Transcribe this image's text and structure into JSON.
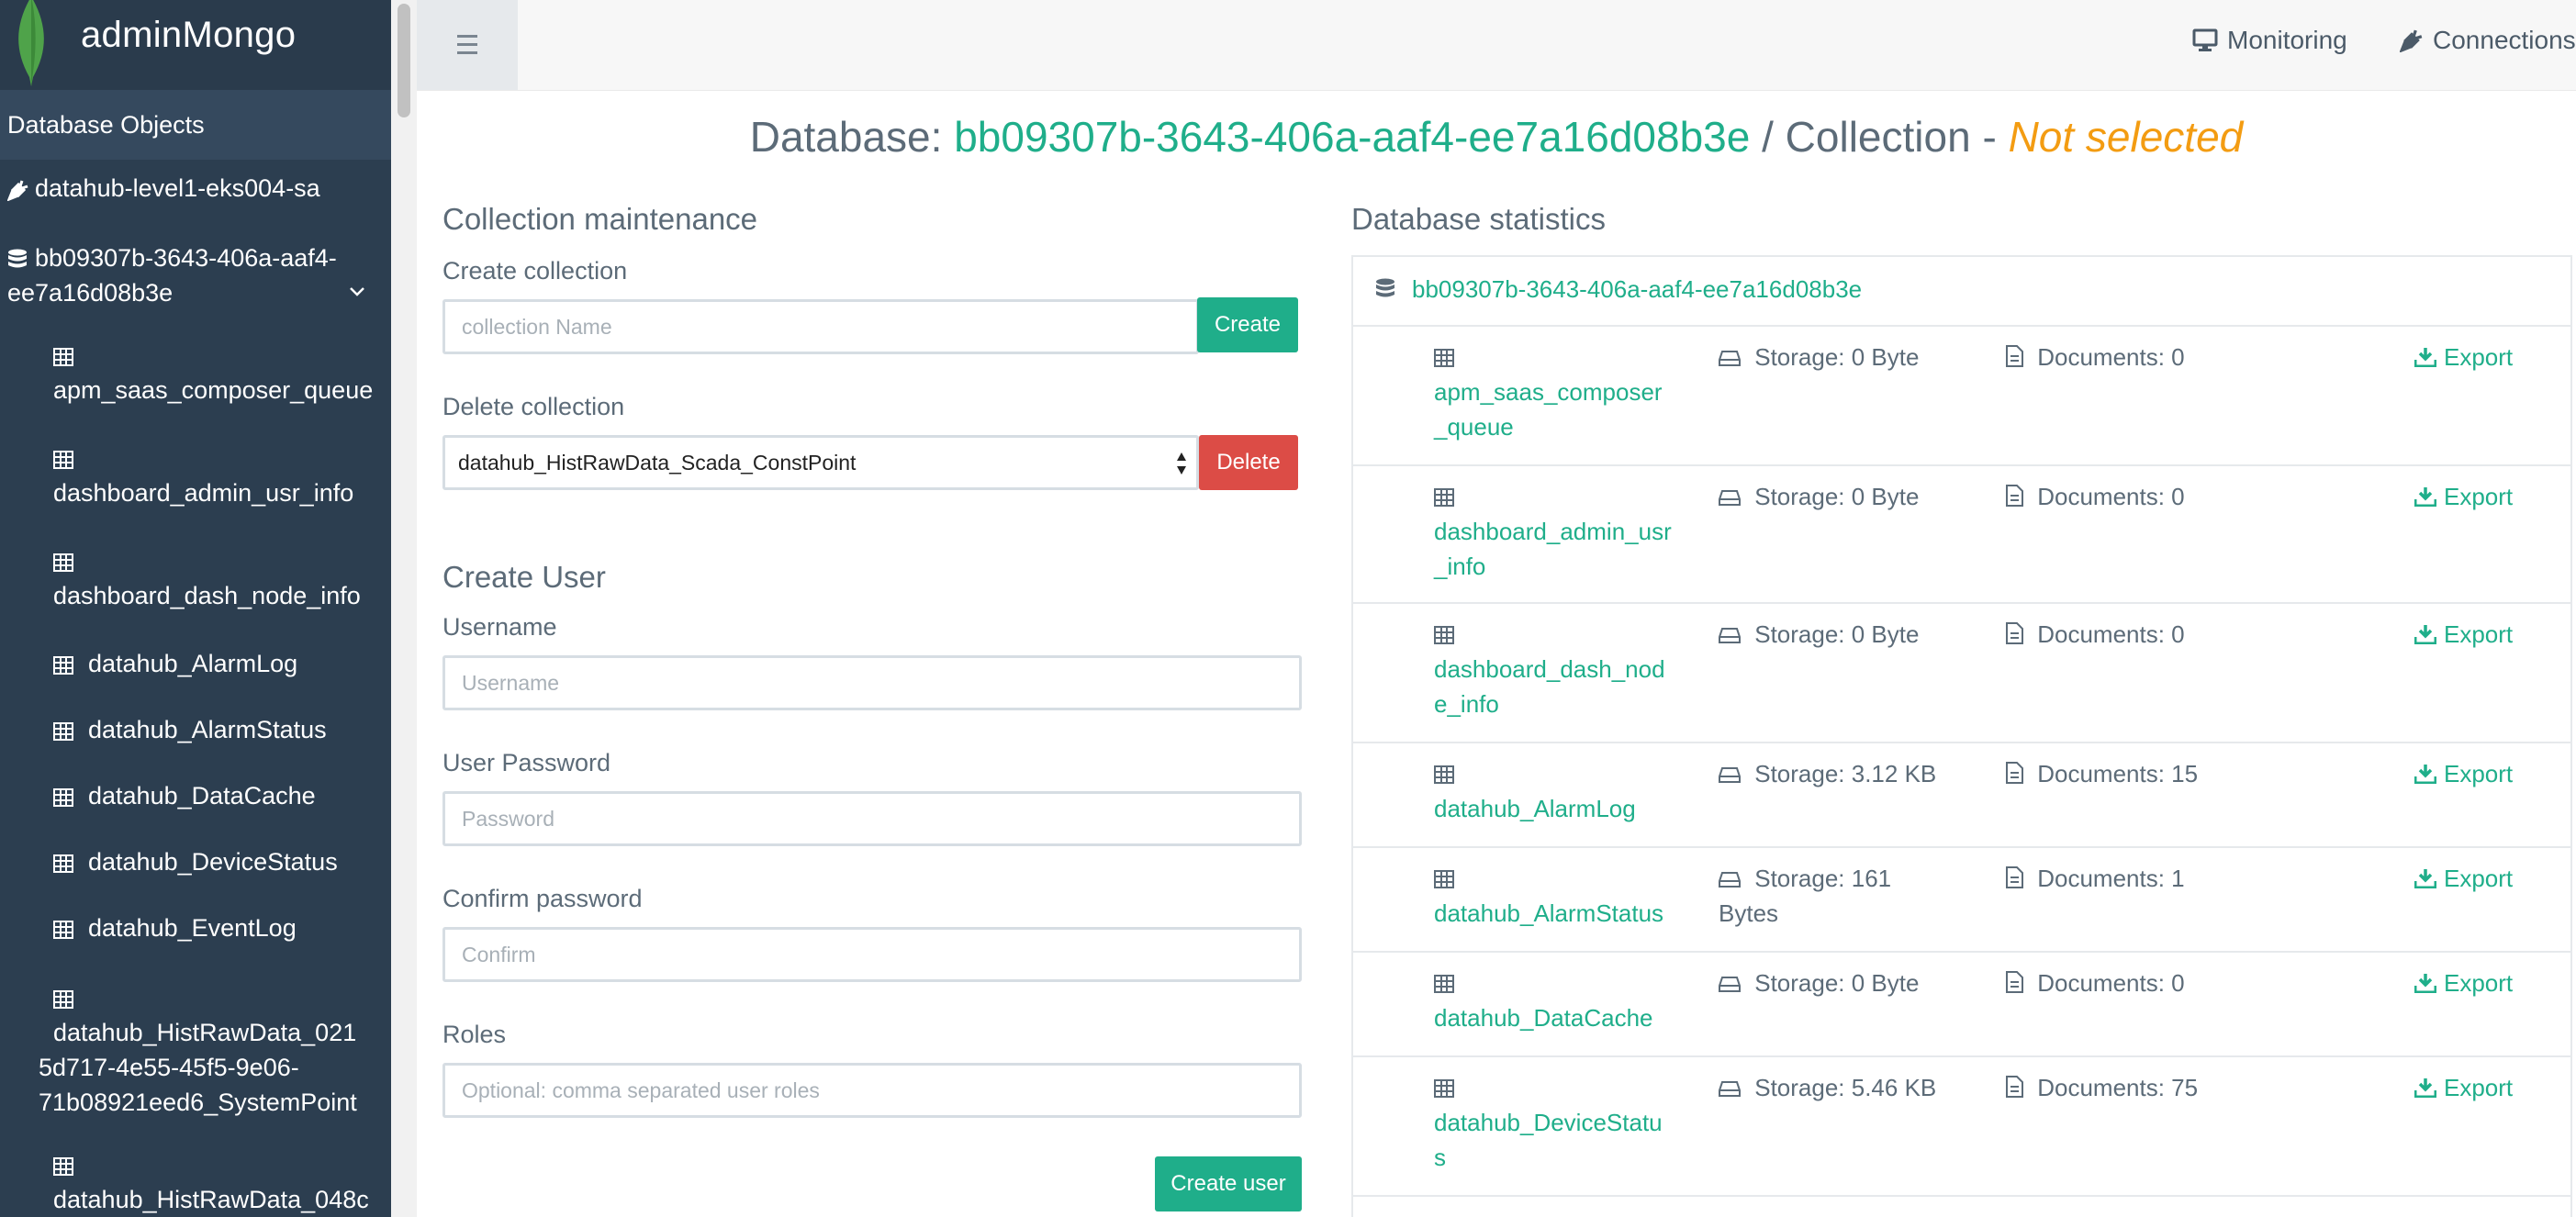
{
  "app": {
    "title": "adminMongo"
  },
  "sidebar": {
    "section_title": "Database Objects",
    "connection": "datahub-level1-eks004-sa",
    "database_line1": "bb09307b-3643-406a-aaf4-",
    "database_line2": "ee7a16d08b3e",
    "collections": [
      "apm_saas_composer_queue",
      "dashboard_admin_usr_info",
      "dashboard_dash_node_info",
      "datahub_AlarmLog",
      "datahub_AlarmStatus",
      "datahub_DataCache",
      "datahub_DeviceStatus",
      "datahub_EventLog"
    ],
    "long_item_1": [
      "datahub_HistRawData_021",
      "5d717-4e55-45f5-9e06-",
      "71b08921eed6_SystemPoint"
    ],
    "long_item_2": "datahub_HistRawData_048c"
  },
  "topbar": {
    "monitoring": "Monitoring",
    "connections": "Connections"
  },
  "heading": {
    "db_prefix": "Database: ",
    "db_name": "bb09307b-3643-406a-aaf4-ee7a16d08b3e",
    "collection_prefix": " / Collection - ",
    "collection_state": "Not selected"
  },
  "maintenance": {
    "title": "Collection maintenance",
    "create_label": "Create collection",
    "create_placeholder": "collection Name",
    "create_button": "Create",
    "delete_label": "Delete collection",
    "delete_selected": "datahub_HistRawData_Scada_ConstPoint",
    "delete_button": "Delete"
  },
  "create_user": {
    "title": "Create User",
    "username_label": "Username",
    "username_placeholder": "Username",
    "password_label": "User Password",
    "password_placeholder": "Password",
    "confirm_label": "Confirm password",
    "confirm_placeholder": "Confirm",
    "roles_label": "Roles",
    "roles_placeholder": "Optional: comma separated user roles",
    "submit": "Create user"
  },
  "stats": {
    "title": "Database statistics",
    "db_name": "bb09307b-3643-406a-aaf4-ee7a16d08b3e",
    "export_label": "Export",
    "rows": [
      {
        "name": "apm_saas_composer_queue",
        "storage": "Storage: 0 Byte",
        "documents": "Documents: 0"
      },
      {
        "name": "dashboard_admin_usr_info",
        "storage": "Storage: 0 Byte",
        "documents": "Documents: 0"
      },
      {
        "name": "dashboard_dash_node_info",
        "storage": "Storage: 0 Byte",
        "documents": "Documents: 0"
      },
      {
        "name": "datahub_AlarmLog",
        "storage": "Storage: 3.12 KB",
        "documents": "Documents: 15"
      },
      {
        "name": "datahub_AlarmStatus",
        "storage": "Storage: 161 Bytes",
        "documents": "Documents: 1"
      },
      {
        "name": "datahub_DataCache",
        "storage": "Storage: 0 Byte",
        "documents": "Documents: 0"
      },
      {
        "name": "datahub_DeviceStatus",
        "storage": "Storage: 5.46 KB",
        "documents": "Documents: 75"
      }
    ]
  },
  "colors": {
    "accent": "#1fae8a",
    "danger": "#dc4c46",
    "warning": "#f39c12",
    "sidebar": "#2c3e50"
  }
}
